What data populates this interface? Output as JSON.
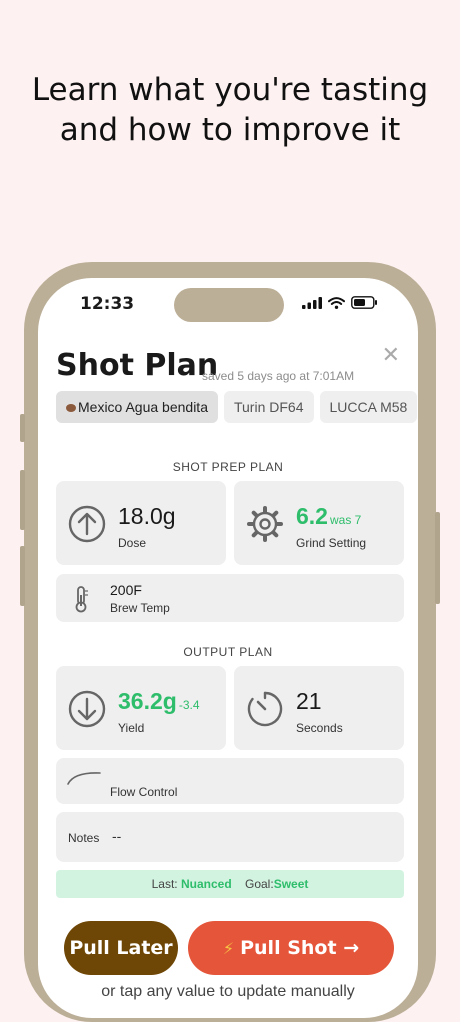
{
  "headline": {
    "line1": "Learn what you're tasting",
    "line2": "and how to improve it"
  },
  "status": {
    "time": "12:33"
  },
  "title": "Shot Plan",
  "saved_text": "saved 5 days ago at 7:01AM",
  "chips": [
    "Mexico Agua bendita",
    "Turin DF64",
    "LUCCA M58"
  ],
  "prep": {
    "label": "SHOT PREP PLAN",
    "dose": {
      "value": "18.0g",
      "label": "Dose"
    },
    "grind": {
      "value": "6.2",
      "was": "was 7",
      "label": "Grind Setting"
    },
    "temp": {
      "value": "200F",
      "label": "Brew Temp"
    }
  },
  "output": {
    "label": "OUTPUT PLAN",
    "yield": {
      "value": "36.2g",
      "delta": "-3.4",
      "label": "Yield"
    },
    "seconds": {
      "value": "21",
      "label": "Seconds"
    },
    "flow": {
      "label": "Flow Control"
    },
    "notes": {
      "label": "Notes",
      "value": "--"
    }
  },
  "goal": {
    "last_label": "Last:",
    "last_value": "Nuanced",
    "goal_label": "Goal:",
    "goal_value": "Sweet"
  },
  "buttons": {
    "later": "Pull Later",
    "shot": "Pull Shot",
    "shot_arrow": "→"
  },
  "footer": "or tap any value to update manually",
  "colors": {
    "background": "#fdf2f1",
    "phone": "#bcaf98",
    "accent_green": "#2ebd6b",
    "pull_later": "#6e4605",
    "pull_shot": "#e4553a"
  }
}
